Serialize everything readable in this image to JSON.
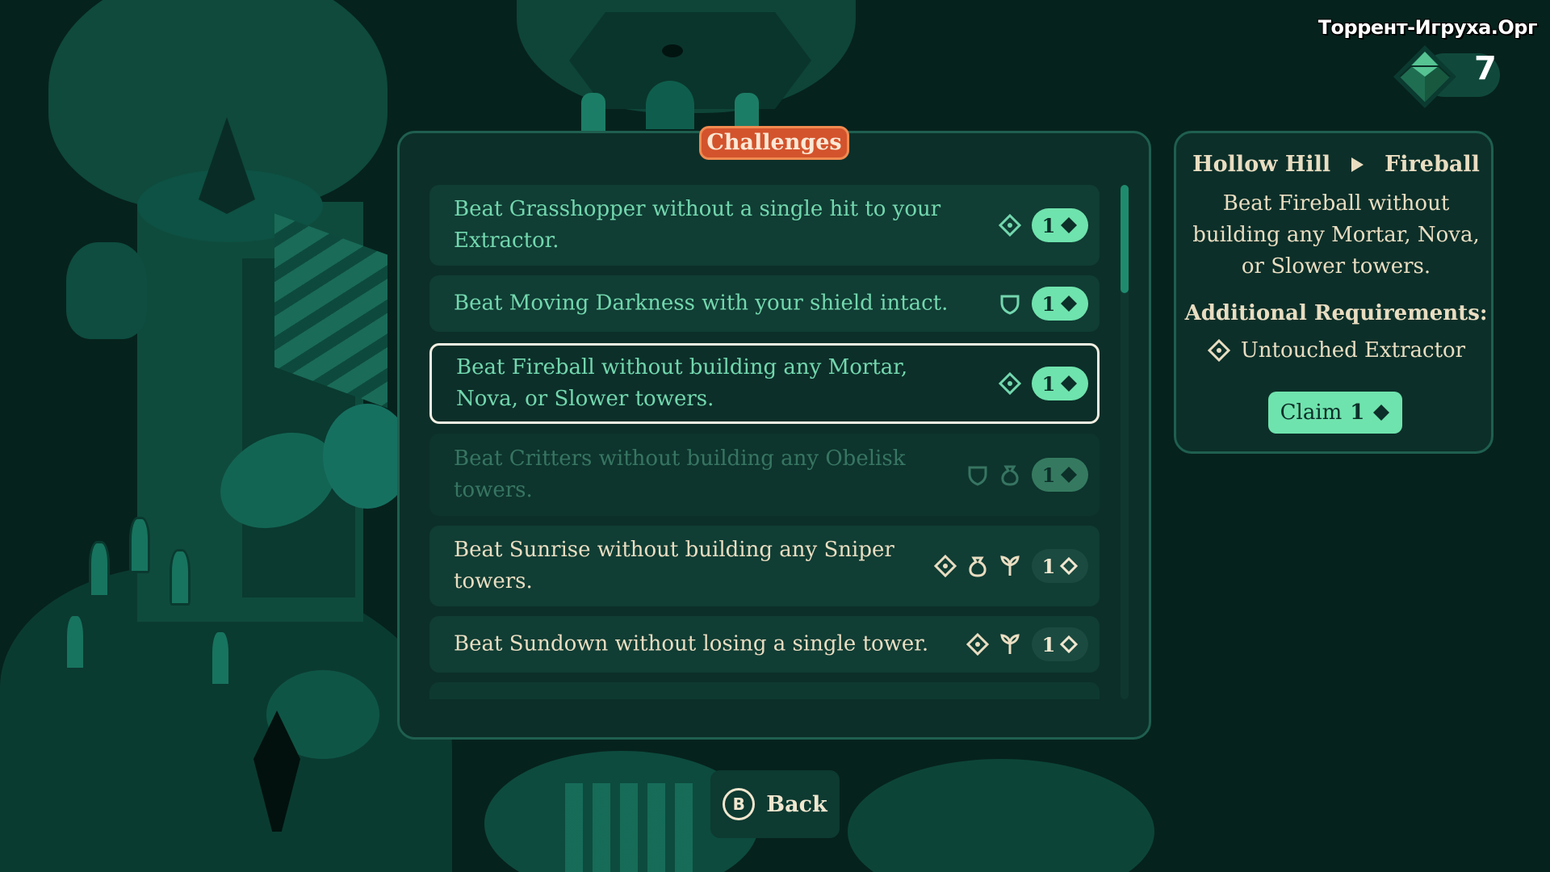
{
  "watermark": "Торрент-Игруха.Орг",
  "currency": {
    "icon": "emerald-gem-icon",
    "count": "7"
  },
  "challenges_panel": {
    "title": "Challenges",
    "scroll_position": 0.0,
    "items": [
      {
        "text": "Beat Grasshopper without a single hit to your Extractor.",
        "requirements": [
          "untouched-extractor-icon"
        ],
        "reward": "1",
        "reward_claimed": false,
        "state": "available"
      },
      {
        "text": "Beat Moving Darkness with your shield intact.",
        "requirements": [
          "shield-icon"
        ],
        "reward": "1",
        "reward_claimed": false,
        "state": "available"
      },
      {
        "text": "Beat Fireball without building any Mortar, Nova, or Slower towers.",
        "requirements": [
          "untouched-extractor-icon"
        ],
        "reward": "1",
        "reward_claimed": false,
        "state": "selected"
      },
      {
        "text": "Beat Critters without building any Obelisk towers.",
        "requirements": [
          "shield-icon",
          "bag-icon"
        ],
        "reward": "1",
        "reward_claimed": false,
        "state": "locked"
      },
      {
        "text": "Beat Sunrise without building any Sniper towers.",
        "requirements": [
          "untouched-extractor-icon",
          "bag-icon",
          "plant-icon"
        ],
        "reward": "1",
        "reward_claimed": true,
        "state": "claimed"
      },
      {
        "text": "Beat Sundown without losing a single tower.",
        "requirements": [
          "untouched-extractor-icon",
          "plant-icon"
        ],
        "reward": "1",
        "reward_claimed": true,
        "state": "claimed"
      }
    ]
  },
  "detail": {
    "location": "Hollow Hill",
    "level": "Fireball",
    "description": "Beat Fireball without building any Mortar, Nova, or Slower towers.",
    "requirements_heading": "Additional Requirements:",
    "requirement": {
      "icon": "untouched-extractor-icon",
      "label": "Untouched Extractor"
    },
    "claim_label": "Claim",
    "claim_amount": "1"
  },
  "back": {
    "glyph": "B",
    "label": "Back"
  },
  "colors": {
    "background": "#06221d",
    "panel": "#0c2f29",
    "accent_green": "#6fe3ad",
    "text_green": "#73d7ae",
    "text_cream": "#e9ddc1",
    "title_orange": "#d3532c"
  }
}
